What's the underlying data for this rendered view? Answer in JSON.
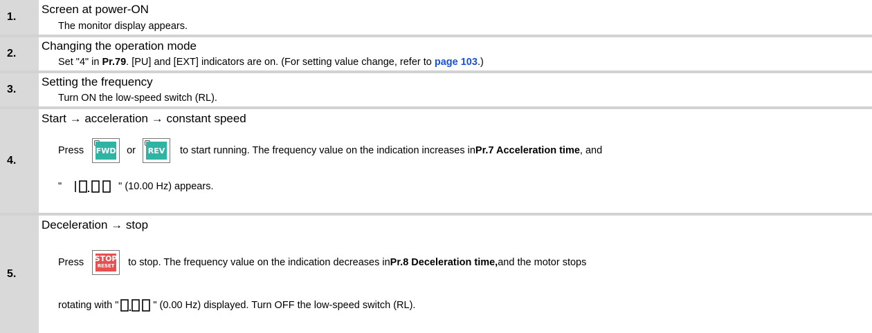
{
  "steps": [
    {
      "number": "1.",
      "title": "Screen at power-ON",
      "text": "The monitor display appears."
    },
    {
      "number": "2.",
      "title": "Changing the operation mode",
      "text_a": "Set \"4\" in ",
      "param": "Pr.79",
      "text_b": ". [PU] and [EXT] indicators are on. (For setting value change, refer to ",
      "link": "page 103",
      "text_c": ".)"
    },
    {
      "number": "3.",
      "title": "Setting the frequency",
      "text": "Turn ON the low-speed switch (RL)."
    },
    {
      "number": "4.",
      "title": "Start → acceleration → constant speed",
      "press": "Press",
      "fwd_key": "FWD",
      "or": "or",
      "rev_key": "REV",
      "text_a": "to start running. The frequency value on the indication increases in ",
      "param": "Pr.7 Acceleration time",
      "text_b": ", and",
      "quote_open": "\"",
      "quote_close": "\" (10.00 Hz) appears.",
      "display_value": "10.00"
    },
    {
      "number": "5.",
      "title": "Deceleration → stop",
      "press": "Press",
      "stop_key_top": "STOP",
      "stop_key_bottom": "RESET",
      "text_a": "to stop. The frequency value on the indication decreases in ",
      "param": "Pr.8 Deceleration time,",
      "text_b": " and the motor stops",
      "line2_a": "rotating with \"",
      "line2_b": "\" (0.00 Hz) displayed. Turn OFF the low-speed switch (RL).",
      "display_value": "0.00"
    }
  ],
  "colors": {
    "number_cell": "#d9d9d9",
    "link": "#1a50d8",
    "key_green": "#2fb3a3",
    "key_red": "#e8504f"
  }
}
